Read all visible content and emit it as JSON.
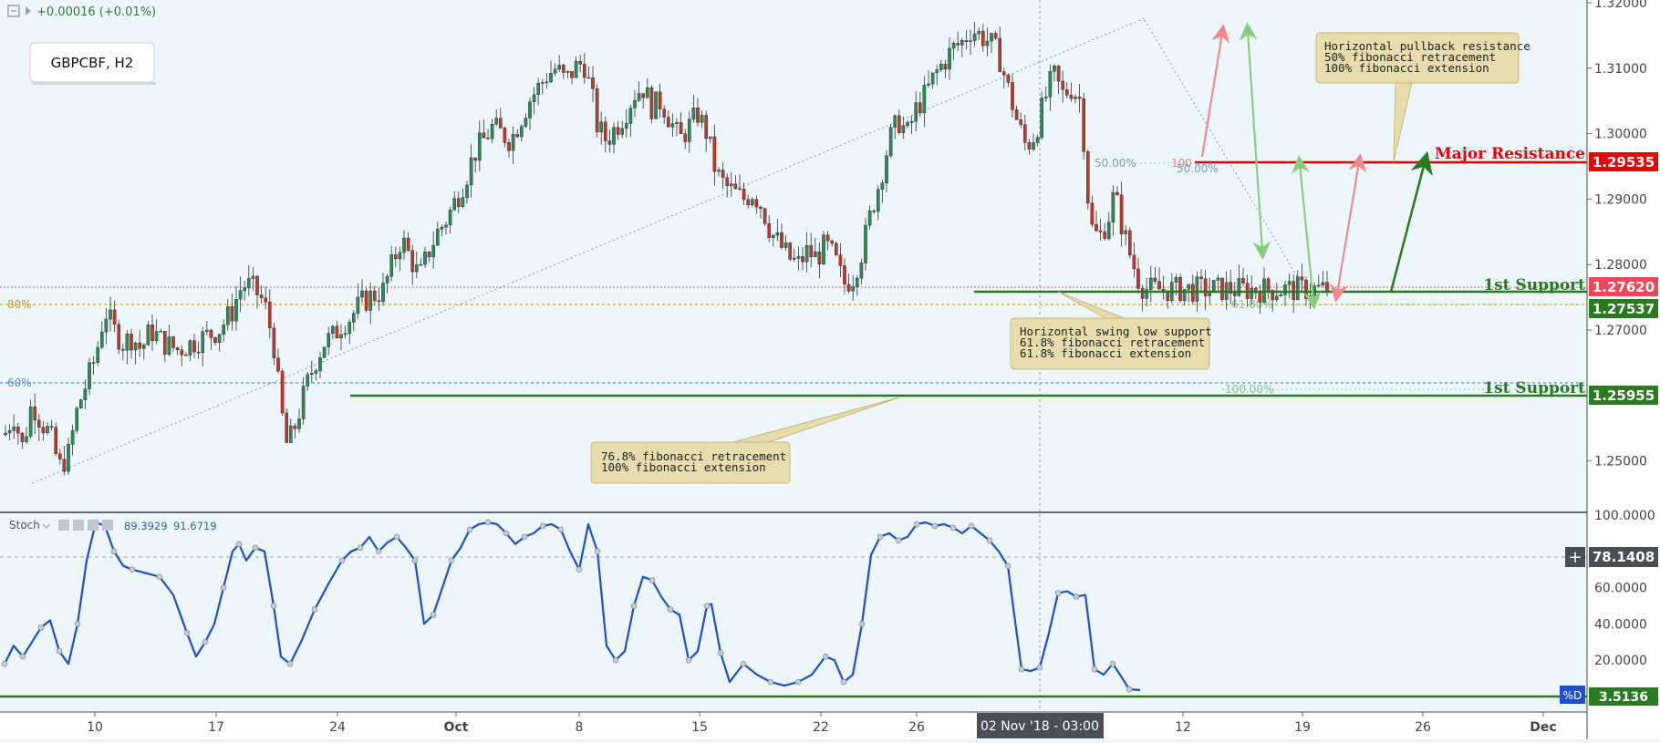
{
  "header": {
    "change_text": "+0.00016 (+0.01%)",
    "symbol": "GBPCBF, H2"
  },
  "colors": {
    "background": "#ecf6fb",
    "up_candle": "#2e8b57",
    "down_candle": "#c0392b",
    "resistance": "#e8000b",
    "support": "#2a7a1f",
    "stoch_line": "#1e4fc8",
    "annotation_fill": "#e6dcad",
    "fib_blue": "#6aa2d8",
    "fib_gold": "#d4b04a"
  },
  "price_axis": {
    "ticks": [
      "1.32000",
      "1.31000",
      "1.30000",
      "1.29000",
      "1.28000",
      "1.27000",
      "1.25000"
    ],
    "tick_values": [
      1.32,
      1.31,
      1.3,
      1.29,
      1.28,
      1.27,
      1.25
    ]
  },
  "stoch_axis": {
    "ticks": [
      "100.0000",
      "60.0000",
      "40.0000",
      "20.0000"
    ],
    "tick_values": [
      100,
      60,
      40,
      20
    ]
  },
  "time_axis": {
    "labels": [
      "10",
      "17",
      "24",
      "Oct",
      "8",
      "15",
      "22",
      "26",
      "12",
      "19",
      "26",
      "Dec"
    ],
    "highlight": "02 Nov '18 - 03:00"
  },
  "levels": {
    "major_resistance": {
      "label": "Major Resistance",
      "value": "1.29535",
      "price": 1.29535
    },
    "support1": {
      "label": "1st Support",
      "value": "1.27537",
      "price": 1.27537
    },
    "support2": {
      "label": "1st Support",
      "value": "1.25955",
      "price": 1.25955
    },
    "current_price": {
      "value": "1.27620",
      "price": 1.2762
    },
    "stoch_current": {
      "value": "78.1408",
      "level": 78.1408
    },
    "stoch_d": {
      "label": "%D",
      "value": "3.5136",
      "level": 3.5136
    }
  },
  "fib_labels": {
    "fib80": "80%",
    "fib60": "60%",
    "fib50a": "50.00%",
    "fib50b": "50.00%",
    "fib100a": "100",
    "fib618": "61.80%",
    "fib100b": "100.00%"
  },
  "annotations": {
    "pullback": [
      "Horizontal pullback resistance",
      "50% fibonacci retracement",
      "100% fibonacci extension"
    ],
    "swing_low": [
      "Horizontal swing low support",
      "61.8% fibonacci retracement",
      "61.8% fibonacci extension"
    ],
    "fib768": [
      "76.8% fibonacci retracement",
      "100% fibonacci extension"
    ]
  },
  "stoch_header": {
    "name": "Stoch",
    "k": "89.3929",
    "d": "91.6719"
  },
  "chart_data": {
    "type": "candlestick",
    "symbol": "GBPCBF",
    "timeframe": "H2",
    "y_range": [
      1.242,
      1.32
    ],
    "price_path": [
      [
        5,
        1.254
      ],
      [
        15,
        1.257
      ],
      [
        25,
        1.252
      ],
      [
        35,
        1.259
      ],
      [
        45,
        1.256
      ],
      [
        55,
        1.254
      ],
      [
        65,
        1.249
      ],
      [
        75,
        1.251
      ],
      [
        85,
        1.258
      ],
      [
        95,
        1.262
      ],
      [
        105,
        1.266
      ],
      [
        115,
        1.273
      ],
      [
        125,
        1.27
      ],
      [
        135,
        1.268
      ],
      [
        145,
        1.269
      ],
      [
        155,
        1.267
      ],
      [
        165,
        1.27
      ],
      [
        180,
        1.268
      ],
      [
        195,
        1.267
      ],
      [
        210,
        1.268
      ],
      [
        225,
        1.269
      ],
      [
        240,
        1.27
      ],
      [
        255,
        1.273
      ],
      [
        262,
        1.276
      ],
      [
        270,
        1.277
      ],
      [
        280,
        1.276
      ],
      [
        290,
        1.274
      ],
      [
        300,
        1.268
      ],
      [
        308,
        1.258
      ],
      [
        315,
        1.252
      ],
      [
        325,
        1.256
      ],
      [
        335,
        1.261
      ],
      [
        345,
        1.265
      ],
      [
        355,
        1.268
      ],
      [
        365,
        1.269
      ],
      [
        375,
        1.271
      ],
      [
        385,
        1.272
      ],
      [
        395,
        1.274
      ],
      [
        405,
        1.275
      ],
      [
        420,
        1.276
      ],
      [
        430,
        1.28
      ],
      [
        440,
        1.284
      ],
      [
        450,
        1.281
      ],
      [
        460,
        1.278
      ],
      [
        470,
        1.282
      ],
      [
        480,
        1.285
      ],
      [
        490,
        1.287
      ],
      [
        500,
        1.29
      ],
      [
        510,
        1.293
      ],
      [
        520,
        1.297
      ],
      [
        530,
        1.299
      ],
      [
        540,
        1.301
      ],
      [
        550,
        1.3
      ],
      [
        560,
        1.299
      ],
      [
        570,
        1.302
      ],
      [
        580,
        1.305
      ],
      [
        590,
        1.307
      ],
      [
        600,
        1.309
      ],
      [
        610,
        1.31
      ],
      [
        620,
        1.308
      ],
      [
        630,
        1.31
      ],
      [
        640,
        1.311
      ],
      [
        650,
        1.305
      ],
      [
        655,
        1.301
      ],
      [
        665,
        1.299
      ],
      [
        675,
        1.301
      ],
      [
        685,
        1.303
      ],
      [
        695,
        1.306
      ],
      [
        705,
        1.307
      ],
      [
        715,
        1.304
      ],
      [
        725,
        1.305
      ],
      [
        735,
        1.302
      ],
      [
        745,
        1.299
      ],
      [
        755,
        1.301
      ],
      [
        765,
        1.303
      ],
      [
        775,
        1.3
      ],
      [
        785,
        1.294
      ],
      [
        795,
        1.292
      ],
      [
        805,
        1.291
      ],
      [
        815,
        1.29
      ],
      [
        825,
        1.291
      ],
      [
        835,
        1.289
      ],
      [
        845,
        1.285
      ],
      [
        855,
        1.283
      ],
      [
        865,
        1.281
      ],
      [
        875,
        1.28
      ],
      [
        885,
        1.282
      ],
      [
        895,
        1.281
      ],
      [
        905,
        1.283
      ],
      [
        915,
        1.281
      ],
      [
        925,
        1.277
      ],
      [
        935,
        1.278
      ],
      [
        945,
        1.282
      ],
      [
        955,
        1.288
      ],
      [
        965,
        1.293
      ],
      [
        975,
        1.299
      ],
      [
        985,
        1.302
      ],
      [
        995,
        1.3
      ],
      [
        1005,
        1.304
      ],
      [
        1015,
        1.306
      ],
      [
        1025,
        1.309
      ],
      [
        1035,
        1.311
      ],
      [
        1045,
        1.313
      ],
      [
        1055,
        1.314
      ],
      [
        1065,
        1.316
      ],
      [
        1075,
        1.315
      ],
      [
        1085,
        1.314
      ],
      [
        1095,
        1.312
      ],
      [
        1105,
        1.307
      ],
      [
        1115,
        1.302
      ],
      [
        1125,
        1.298
      ],
      [
        1135,
        1.3
      ],
      [
        1145,
        1.305
      ],
      [
        1155,
        1.309
      ],
      [
        1165,
        1.306
      ],
      [
        1175,
        1.307
      ],
      [
        1185,
        1.305
      ],
      [
        1190,
        1.296
      ],
      [
        1195,
        1.286
      ],
      [
        1205,
        1.284
      ],
      [
        1215,
        1.287
      ],
      [
        1222,
        1.291
      ],
      [
        1230,
        1.286
      ],
      [
        1240,
        1.281
      ],
      [
        1250,
        1.277
      ],
      [
        1258,
        1.2762
      ]
    ],
    "stochastic": {
      "k_last": 89.3929,
      "d_last": 91.6719,
      "points": [
        [
          5,
          18
        ],
        [
          15,
          28
        ],
        [
          25,
          22
        ],
        [
          35,
          30
        ],
        [
          45,
          38
        ],
        [
          55,
          42
        ],
        [
          65,
          25
        ],
        [
          75,
          18
        ],
        [
          85,
          40
        ],
        [
          95,
          75
        ],
        [
          105,
          96
        ],
        [
          115,
          94
        ],
        [
          125,
          80
        ],
        [
          135,
          72
        ],
        [
          145,
          70
        ],
        [
          160,
          68
        ],
        [
          175,
          66
        ],
        [
          190,
          56
        ],
        [
          205,
          35
        ],
        [
          215,
          22
        ],
        [
          225,
          30
        ],
        [
          235,
          40
        ],
        [
          245,
          60
        ],
        [
          255,
          80
        ],
        [
          262,
          84
        ],
        [
          270,
          75
        ],
        [
          280,
          82
        ],
        [
          290,
          80
        ],
        [
          300,
          50
        ],
        [
          308,
          22
        ],
        [
          318,
          18
        ],
        [
          330,
          30
        ],
        [
          345,
          48
        ],
        [
          360,
          62
        ],
        [
          375,
          75
        ],
        [
          385,
          80
        ],
        [
          395,
          82
        ],
        [
          405,
          88
        ],
        [
          415,
          80
        ],
        [
          425,
          85
        ],
        [
          435,
          88
        ],
        [
          445,
          82
        ],
        [
          455,
          75
        ],
        [
          465,
          40
        ],
        [
          475,
          45
        ],
        [
          485,
          60
        ],
        [
          495,
          75
        ],
        [
          505,
          82
        ],
        [
          515,
          92
        ],
        [
          525,
          95
        ],
        [
          535,
          96
        ],
        [
          545,
          95
        ],
        [
          555,
          90
        ],
        [
          565,
          84
        ],
        [
          575,
          88
        ],
        [
          585,
          90
        ],
        [
          595,
          94
        ],
        [
          605,
          95
        ],
        [
          615,
          92
        ],
        [
          625,
          80
        ],
        [
          635,
          70
        ],
        [
          645,
          95
        ],
        [
          655,
          80
        ],
        [
          665,
          28
        ],
        [
          675,
          20
        ],
        [
          685,
          25
        ],
        [
          695,
          50
        ],
        [
          705,
          66
        ],
        [
          715,
          64
        ],
        [
          725,
          55
        ],
        [
          735,
          48
        ],
        [
          745,
          45
        ],
        [
          755,
          20
        ],
        [
          765,
          25
        ],
        [
          775,
          50
        ],
        [
          780,
          51
        ],
        [
          790,
          24
        ],
        [
          800,
          8
        ],
        [
          815,
          18
        ],
        [
          830,
          12
        ],
        [
          845,
          8
        ],
        [
          860,
          6
        ],
        [
          875,
          8
        ],
        [
          890,
          12
        ],
        [
          905,
          22
        ],
        [
          915,
          20
        ],
        [
          925,
          8
        ],
        [
          935,
          12
        ],
        [
          945,
          40
        ],
        [
          955,
          78
        ],
        [
          965,
          88
        ],
        [
          975,
          90
        ],
        [
          985,
          86
        ],
        [
          995,
          88
        ],
        [
          1005,
          95
        ],
        [
          1015,
          96
        ],
        [
          1025,
          94
        ],
        [
          1035,
          95
        ],
        [
          1045,
          93
        ],
        [
          1055,
          90
        ],
        [
          1065,
          94
        ],
        [
          1075,
          90
        ],
        [
          1085,
          86
        ],
        [
          1095,
          80
        ],
        [
          1105,
          72
        ],
        [
          1112,
          45
        ],
        [
          1120,
          15
        ],
        [
          1130,
          14
        ],
        [
          1140,
          16
        ],
        [
          1150,
          35
        ],
        [
          1160,
          57
        ],
        [
          1170,
          58
        ],
        [
          1180,
          55
        ],
        [
          1190,
          56
        ],
        [
          1200,
          15
        ],
        [
          1210,
          12
        ],
        [
          1220,
          18
        ],
        [
          1228,
          12
        ],
        [
          1238,
          4
        ],
        [
          1250,
          3.5136
        ]
      ]
    },
    "horizontal_levels": [
      {
        "name": "Major Resistance",
        "value": 1.29535
      },
      {
        "name": "1st Support",
        "value": 1.27537
      },
      {
        "name": "1st Support",
        "value": 1.25955
      }
    ],
    "fib_levels": [
      {
        "label": "80%"
      },
      {
        "label": "60%"
      },
      {
        "label": "50.00%"
      },
      {
        "label": "61.80%"
      },
      {
        "label": "100.00%"
      }
    ]
  }
}
